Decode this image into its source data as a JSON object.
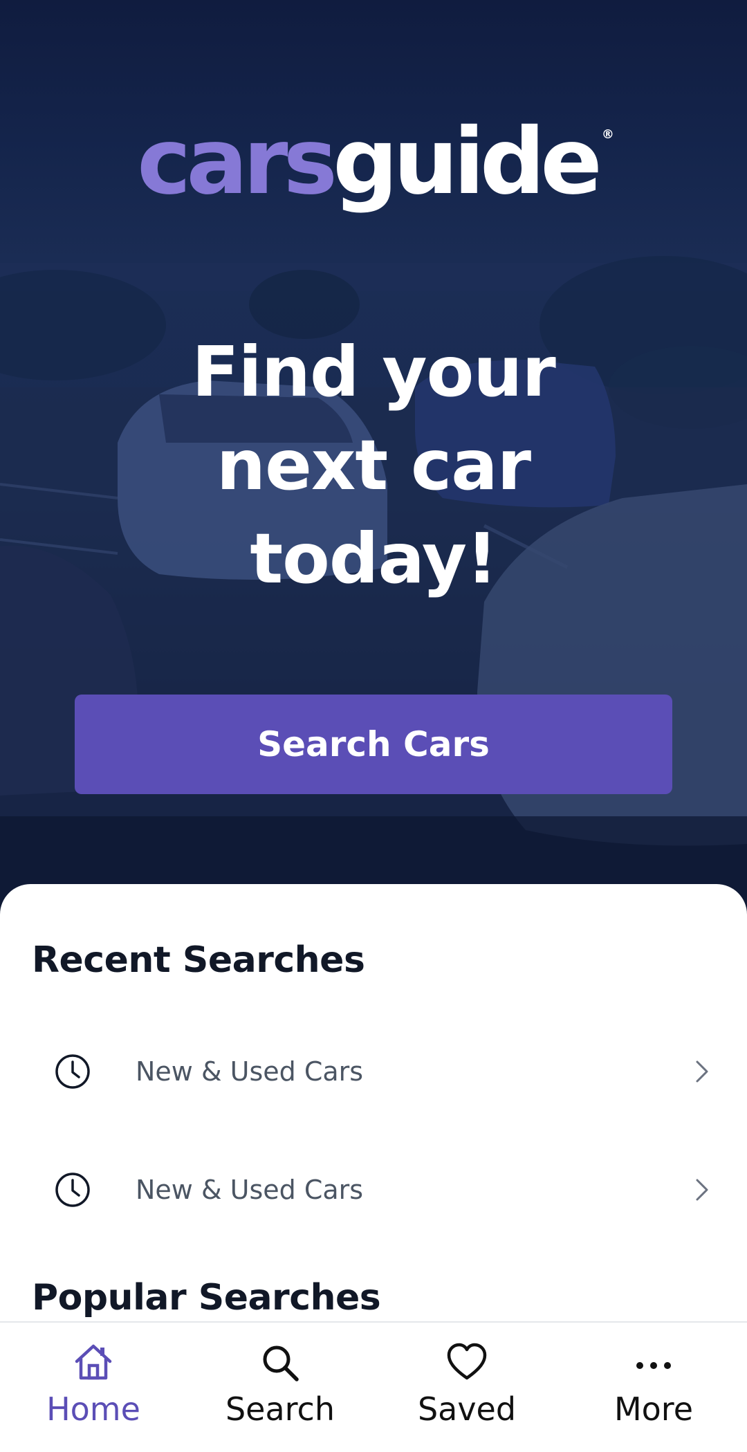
{
  "brand": {
    "logo_part1": "cars",
    "logo_part2": "guide",
    "logo_reg": "®"
  },
  "hero": {
    "headline_line1": "Find your",
    "headline_line2": "next car",
    "headline_line3": "today!",
    "cta_label": "Search Cars"
  },
  "recent_searches": {
    "title": "Recent Searches",
    "items": [
      {
        "label": "New & Used Cars",
        "icon": "clock-icon"
      },
      {
        "label": "New & Used Cars",
        "icon": "clock-icon"
      }
    ]
  },
  "popular_searches": {
    "title": "Popular Searches"
  },
  "bottom_nav": {
    "items": [
      {
        "label": "Home",
        "icon": "home-icon",
        "active": true
      },
      {
        "label": "Search",
        "icon": "search-icon",
        "active": false
      },
      {
        "label": "Saved",
        "icon": "heart-icon",
        "active": false
      },
      {
        "label": "More",
        "icon": "more-icon",
        "active": false
      }
    ]
  },
  "colors": {
    "brand_purple": "#5b4eb6",
    "logo_purple": "#8679d6",
    "hero_overlay": "#14244b",
    "text_dark": "#111827",
    "text_muted": "#4b5563"
  }
}
